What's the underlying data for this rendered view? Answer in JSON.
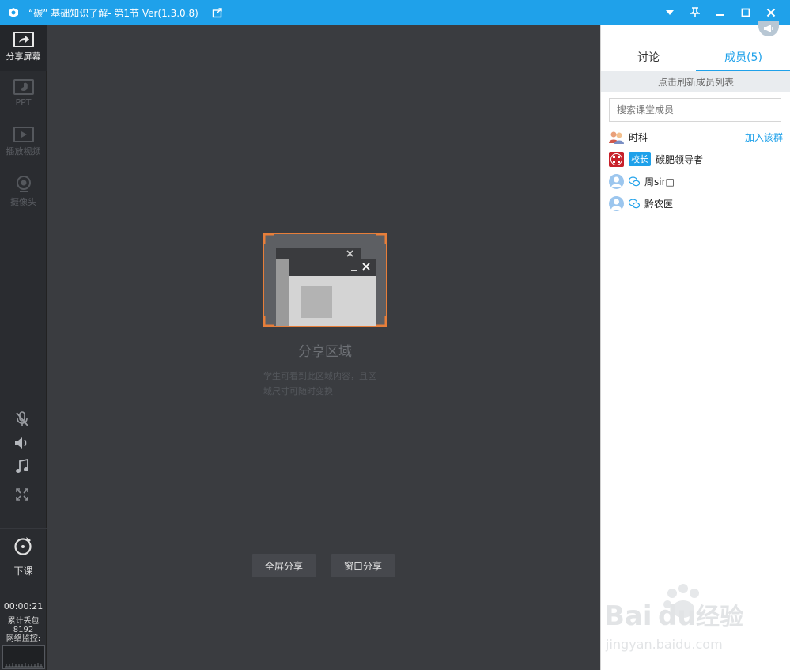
{
  "titlebar": {
    "title": "“碳” 基础知识了解- 第1节 Ver(1.3.0.8)",
    "icons": [
      "app-logo-icon",
      "share-out-icon",
      "dropdown-icon",
      "pin-icon",
      "minimize-icon",
      "maximize-icon",
      "close-icon"
    ]
  },
  "leftbar": {
    "tools": [
      {
        "label": "分享屏幕",
        "icon": "share-screen-icon",
        "state": "active"
      },
      {
        "label": "PPT",
        "icon": "ppt-icon",
        "state": "disabled"
      },
      {
        "label": "播放视频",
        "icon": "play-video-icon",
        "state": "disabled"
      },
      {
        "label": "摄像头",
        "icon": "camera-icon",
        "state": "disabled"
      }
    ],
    "audio_icons": [
      "mic-muted-icon",
      "speaker-icon",
      "music-icon",
      "fullscreen-icon"
    ],
    "end_class_label": "下课",
    "timer": "00:00:21",
    "loss_label": "累计丢包",
    "loss_value": "8192",
    "net_label": "网络监控:"
  },
  "stage": {
    "title": "分享区域",
    "desc_line1": "学生可看到此区域内容，且区",
    "desc_line2": "域尺寸可随时变换",
    "fullscreen_share": "全屏分享",
    "window_share": "窗口分享"
  },
  "rightpanel": {
    "tabs": [
      {
        "label": "讨论",
        "active": false
      },
      {
        "label": "成员(5)",
        "active": true
      }
    ],
    "refresh_label": "点击刷新成员列表",
    "search_placeholder": "搜索课堂成员",
    "members": [
      {
        "name": "时科",
        "avatar": "group-avatar-icon",
        "action": "加入该群"
      },
      {
        "name": "碳肥领导者",
        "avatar": "logo-avatar-icon",
        "badge": "校长"
      },
      {
        "name": "周sir□",
        "avatar": "user-avatar-icon",
        "wechat": true
      },
      {
        "name": "黔农医",
        "avatar": "user-avatar-icon",
        "wechat": true
      }
    ]
  },
  "colors": {
    "accent": "#1fa1ea",
    "stage_bg": "#3a3c40",
    "leftbar_bg": "#2a2c30",
    "share_frame": "#e67e3a"
  }
}
